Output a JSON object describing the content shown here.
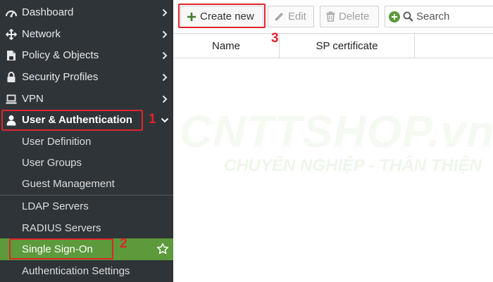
{
  "sidebar": {
    "items": [
      {
        "label": "Dashboard",
        "icon": "dashboard-icon"
      },
      {
        "label": "Network",
        "icon": "network-icon"
      },
      {
        "label": "Policy & Objects",
        "icon": "policy-icon"
      },
      {
        "label": "Security Profiles",
        "icon": "lock-icon"
      },
      {
        "label": "VPN",
        "icon": "vpn-icon"
      },
      {
        "label": "User & Authentication",
        "icon": "user-icon"
      }
    ],
    "sub_items": [
      {
        "label": "User Definition"
      },
      {
        "label": "User Groups"
      },
      {
        "label": "Guest Management"
      },
      {
        "label": "LDAP Servers"
      },
      {
        "label": "RADIUS Servers"
      },
      {
        "label": "Single Sign-On"
      },
      {
        "label": "Authentication Settings"
      }
    ]
  },
  "toolbar": {
    "create_label": "Create new",
    "edit_label": "Edit",
    "delete_label": "Delete",
    "search_placeholder": "Search"
  },
  "table": {
    "columns": [
      "Name",
      "SP certificate"
    ]
  },
  "annotations": [
    "1",
    "2",
    "3"
  ],
  "watermark": {
    "main": "CNTTSHOP.vn",
    "sub": "CHUYÊN NGHIỆP - THÂN THIỆN"
  },
  "colors": {
    "sidebar_bg": "#2f3438",
    "active_bg": "#5c9a3c",
    "annotation_red": "#e0242b",
    "create_plus_green": "#3d7d2b"
  }
}
